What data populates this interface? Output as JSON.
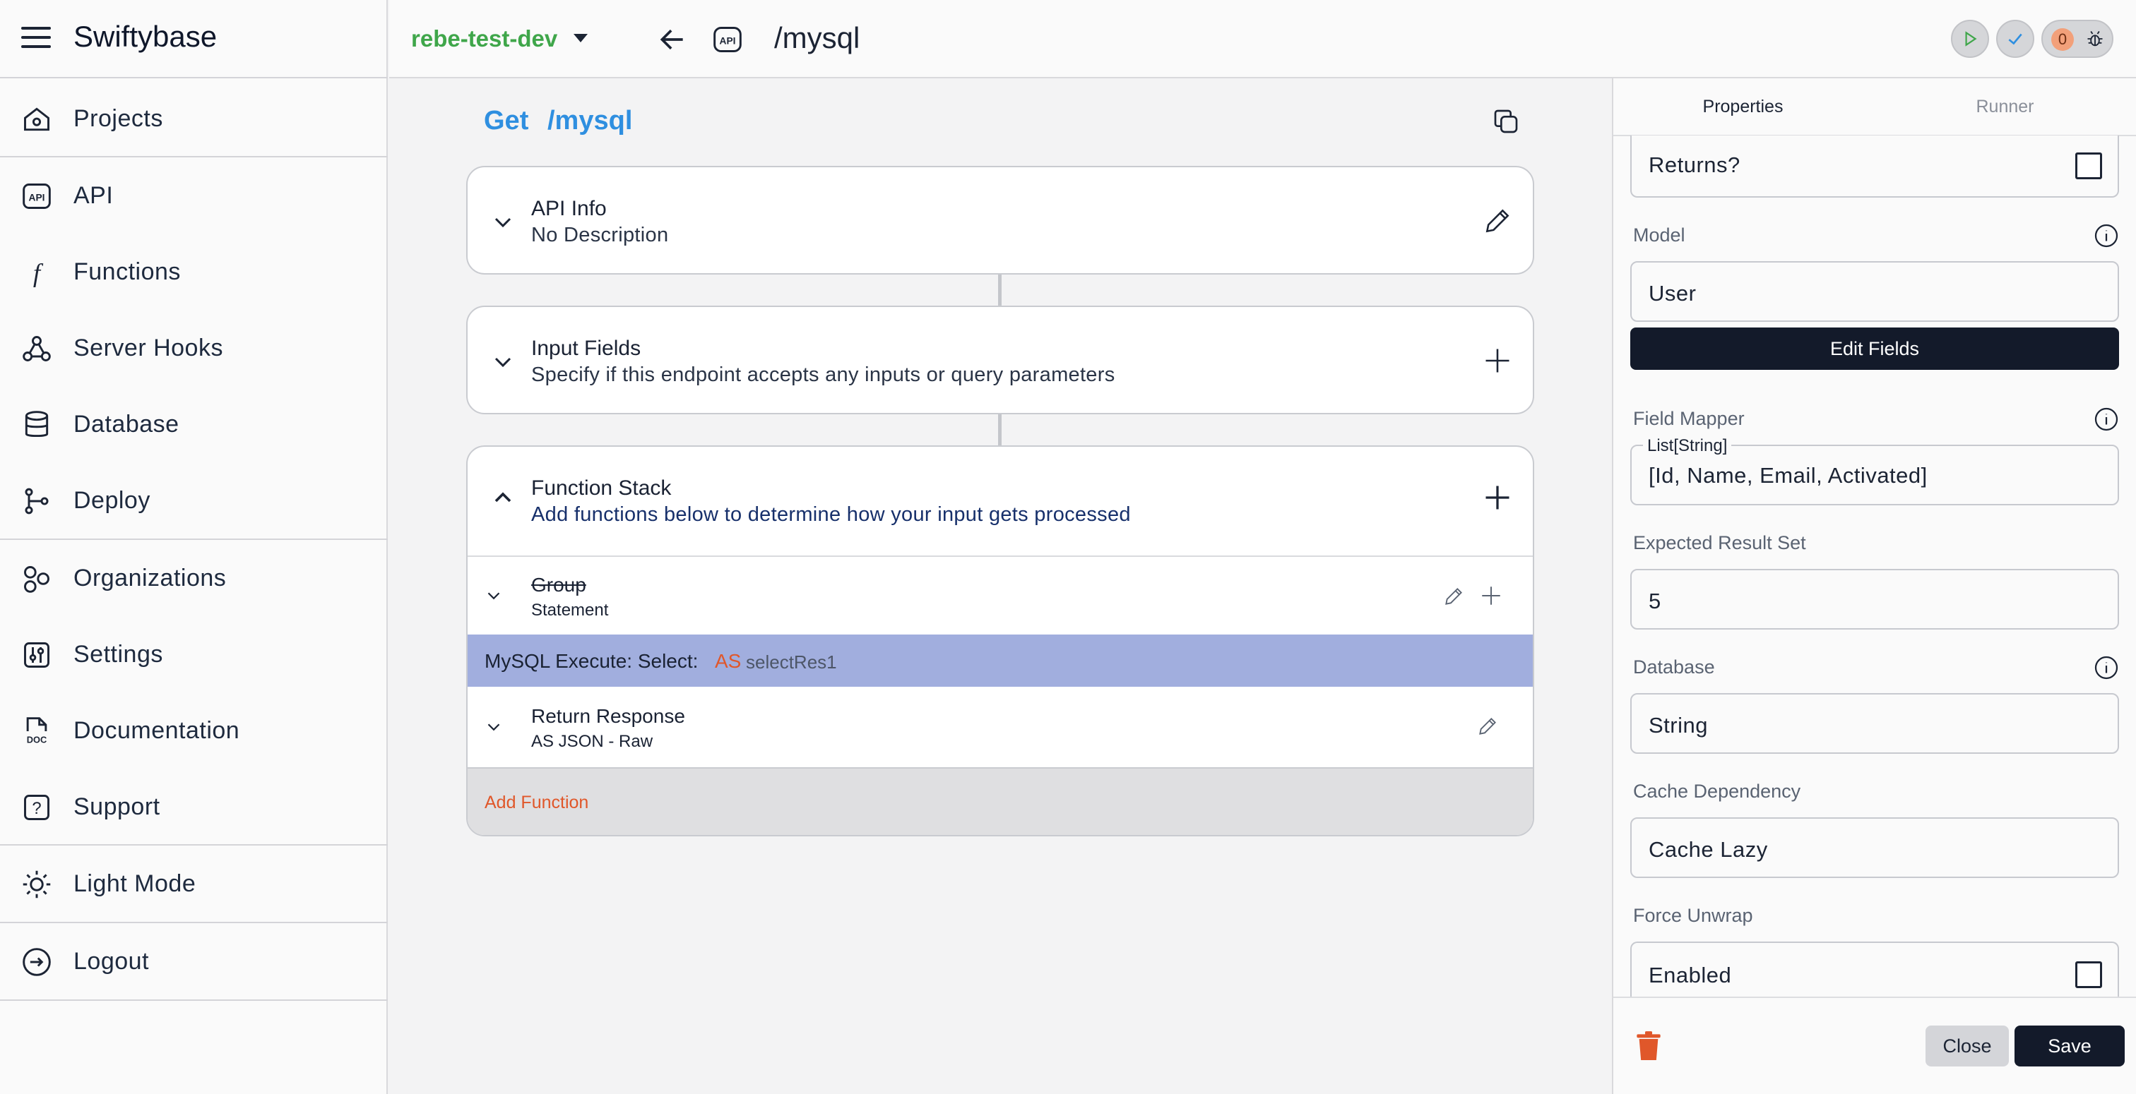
{
  "app": {
    "name": "Swiftybase"
  },
  "sidebar": {
    "items": [
      {
        "label": "Projects",
        "icon": "home-icon"
      },
      {
        "label": "API",
        "icon": "api-icon"
      },
      {
        "label": "Functions",
        "icon": "function-icon"
      },
      {
        "label": "Server Hooks",
        "icon": "webhook-icon"
      },
      {
        "label": "Database",
        "icon": "database-icon"
      },
      {
        "label": "Deploy",
        "icon": "git-branch-icon"
      },
      {
        "label": "Organizations",
        "icon": "shapes-icon"
      },
      {
        "label": "Settings",
        "icon": "settings-sliders-icon"
      },
      {
        "label": "Documentation",
        "icon": "doc-file-icon"
      },
      {
        "label": "Support",
        "icon": "question-icon"
      },
      {
        "label": "Light Mode",
        "icon": "sun-icon"
      },
      {
        "label": "Logout",
        "icon": "logout-icon"
      }
    ]
  },
  "topbar": {
    "project": "rebe-test-dev",
    "route": "/mysql",
    "badge_count": "0"
  },
  "endpoint": {
    "method": "Get",
    "route": "/mysql"
  },
  "cards": {
    "api_info": {
      "title": "API Info",
      "subtitle": "No Description"
    },
    "input_fields": {
      "title": "Input Fields",
      "subtitle": "Specify if this endpoint accepts any inputs or query parameters"
    },
    "function_stack": {
      "title": "Function Stack",
      "subtitle": "Add functions below to determine how your input gets processed"
    }
  },
  "functions": {
    "group": {
      "title": "Group",
      "subtitle": "Statement"
    },
    "mysql": {
      "prefix": "MySQL Execute: Select:",
      "as": "AS",
      "var": "selectRes1"
    },
    "return": {
      "title": "Return Response",
      "subtitle": "AS JSON - Raw"
    },
    "add_label": "Add Function"
  },
  "panel": {
    "tabs": {
      "properties": "Properties",
      "runner": "Runner"
    },
    "returns_label": "Returns?",
    "model": {
      "label": "Model",
      "value": "User"
    },
    "edit_fields": "Edit Fields",
    "field_mapper": {
      "label": "Field Mapper",
      "legend": "List[String]",
      "value": "[Id, Name, Email, Activated]"
    },
    "expected_result": {
      "label": "Expected Result Set",
      "value": "5"
    },
    "database": {
      "label": "Database",
      "value": "String"
    },
    "cache": {
      "label": "Cache Dependency",
      "value": "Cache Lazy"
    },
    "force_unwrap": {
      "label": "Force Unwrap",
      "value": "Enabled"
    },
    "close": "Close",
    "save": "Save"
  },
  "colors": {
    "accent_blue": "#2f8fe0",
    "project_green": "#3fa64a",
    "highlight_row": "#a1aede",
    "as_orange": "#e0572a",
    "dark_button": "#131a2a"
  }
}
